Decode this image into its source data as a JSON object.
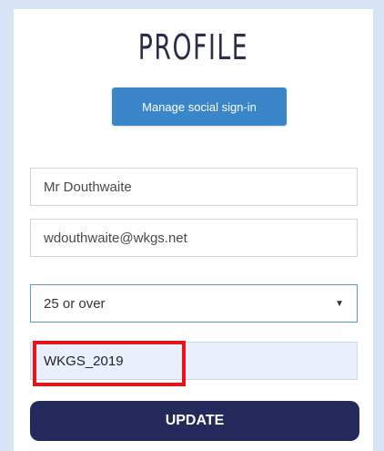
{
  "profile": {
    "title": "PROFILE",
    "social_signin_label": "Manage social sign-in",
    "name_value": "Mr Douthwaite",
    "email_value": "wdouthwaite@wkgs.net",
    "age_selected": "25 or over",
    "code_value": "WKGS_2019",
    "update_label": "UPDATE"
  },
  "colors": {
    "background": "#d6e4f5",
    "social_button": "#3a86c8",
    "update_button": "#23295a",
    "highlight": "#e4161b",
    "autofill_field": "#e8f0fe"
  },
  "icons": {
    "select_caret": "chevron-down-icon"
  }
}
